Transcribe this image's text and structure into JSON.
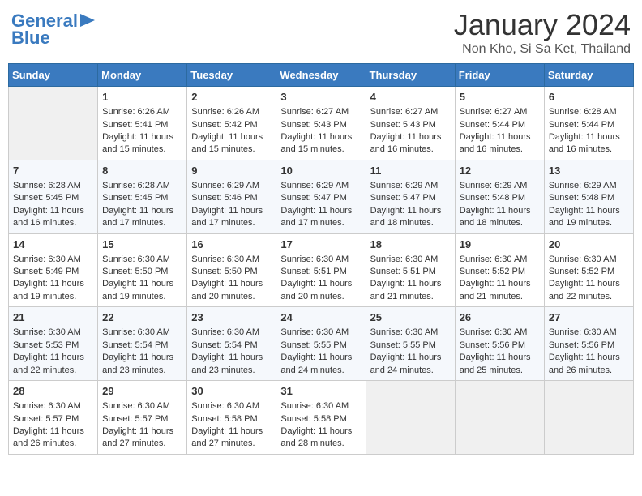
{
  "header": {
    "logo_line1": "General",
    "logo_line2": "Blue",
    "month": "January 2024",
    "location": "Non Kho, Si Sa Ket, Thailand"
  },
  "weekdays": [
    "Sunday",
    "Monday",
    "Tuesday",
    "Wednesday",
    "Thursday",
    "Friday",
    "Saturday"
  ],
  "weeks": [
    [
      {
        "day": "",
        "sunrise": "",
        "sunset": "",
        "daylight": ""
      },
      {
        "day": "1",
        "sunrise": "Sunrise: 6:26 AM",
        "sunset": "Sunset: 5:41 PM",
        "daylight": "Daylight: 11 hours and 15 minutes."
      },
      {
        "day": "2",
        "sunrise": "Sunrise: 6:26 AM",
        "sunset": "Sunset: 5:42 PM",
        "daylight": "Daylight: 11 hours and 15 minutes."
      },
      {
        "day": "3",
        "sunrise": "Sunrise: 6:27 AM",
        "sunset": "Sunset: 5:43 PM",
        "daylight": "Daylight: 11 hours and 15 minutes."
      },
      {
        "day": "4",
        "sunrise": "Sunrise: 6:27 AM",
        "sunset": "Sunset: 5:43 PM",
        "daylight": "Daylight: 11 hours and 16 minutes."
      },
      {
        "day": "5",
        "sunrise": "Sunrise: 6:27 AM",
        "sunset": "Sunset: 5:44 PM",
        "daylight": "Daylight: 11 hours and 16 minutes."
      },
      {
        "day": "6",
        "sunrise": "Sunrise: 6:28 AM",
        "sunset": "Sunset: 5:44 PM",
        "daylight": "Daylight: 11 hours and 16 minutes."
      }
    ],
    [
      {
        "day": "7",
        "sunrise": "Sunrise: 6:28 AM",
        "sunset": "Sunset: 5:45 PM",
        "daylight": "Daylight: 11 hours and 16 minutes."
      },
      {
        "day": "8",
        "sunrise": "Sunrise: 6:28 AM",
        "sunset": "Sunset: 5:45 PM",
        "daylight": "Daylight: 11 hours and 17 minutes."
      },
      {
        "day": "9",
        "sunrise": "Sunrise: 6:29 AM",
        "sunset": "Sunset: 5:46 PM",
        "daylight": "Daylight: 11 hours and 17 minutes."
      },
      {
        "day": "10",
        "sunrise": "Sunrise: 6:29 AM",
        "sunset": "Sunset: 5:47 PM",
        "daylight": "Daylight: 11 hours and 17 minutes."
      },
      {
        "day": "11",
        "sunrise": "Sunrise: 6:29 AM",
        "sunset": "Sunset: 5:47 PM",
        "daylight": "Daylight: 11 hours and 18 minutes."
      },
      {
        "day": "12",
        "sunrise": "Sunrise: 6:29 AM",
        "sunset": "Sunset: 5:48 PM",
        "daylight": "Daylight: 11 hours and 18 minutes."
      },
      {
        "day": "13",
        "sunrise": "Sunrise: 6:29 AM",
        "sunset": "Sunset: 5:48 PM",
        "daylight": "Daylight: 11 hours and 19 minutes."
      }
    ],
    [
      {
        "day": "14",
        "sunrise": "Sunrise: 6:30 AM",
        "sunset": "Sunset: 5:49 PM",
        "daylight": "Daylight: 11 hours and 19 minutes."
      },
      {
        "day": "15",
        "sunrise": "Sunrise: 6:30 AM",
        "sunset": "Sunset: 5:50 PM",
        "daylight": "Daylight: 11 hours and 19 minutes."
      },
      {
        "day": "16",
        "sunrise": "Sunrise: 6:30 AM",
        "sunset": "Sunset: 5:50 PM",
        "daylight": "Daylight: 11 hours and 20 minutes."
      },
      {
        "day": "17",
        "sunrise": "Sunrise: 6:30 AM",
        "sunset": "Sunset: 5:51 PM",
        "daylight": "Daylight: 11 hours and 20 minutes."
      },
      {
        "day": "18",
        "sunrise": "Sunrise: 6:30 AM",
        "sunset": "Sunset: 5:51 PM",
        "daylight": "Daylight: 11 hours and 21 minutes."
      },
      {
        "day": "19",
        "sunrise": "Sunrise: 6:30 AM",
        "sunset": "Sunset: 5:52 PM",
        "daylight": "Daylight: 11 hours and 21 minutes."
      },
      {
        "day": "20",
        "sunrise": "Sunrise: 6:30 AM",
        "sunset": "Sunset: 5:52 PM",
        "daylight": "Daylight: 11 hours and 22 minutes."
      }
    ],
    [
      {
        "day": "21",
        "sunrise": "Sunrise: 6:30 AM",
        "sunset": "Sunset: 5:53 PM",
        "daylight": "Daylight: 11 hours and 22 minutes."
      },
      {
        "day": "22",
        "sunrise": "Sunrise: 6:30 AM",
        "sunset": "Sunset: 5:54 PM",
        "daylight": "Daylight: 11 hours and 23 minutes."
      },
      {
        "day": "23",
        "sunrise": "Sunrise: 6:30 AM",
        "sunset": "Sunset: 5:54 PM",
        "daylight": "Daylight: 11 hours and 23 minutes."
      },
      {
        "day": "24",
        "sunrise": "Sunrise: 6:30 AM",
        "sunset": "Sunset: 5:55 PM",
        "daylight": "Daylight: 11 hours and 24 minutes."
      },
      {
        "day": "25",
        "sunrise": "Sunrise: 6:30 AM",
        "sunset": "Sunset: 5:55 PM",
        "daylight": "Daylight: 11 hours and 24 minutes."
      },
      {
        "day": "26",
        "sunrise": "Sunrise: 6:30 AM",
        "sunset": "Sunset: 5:56 PM",
        "daylight": "Daylight: 11 hours and 25 minutes."
      },
      {
        "day": "27",
        "sunrise": "Sunrise: 6:30 AM",
        "sunset": "Sunset: 5:56 PM",
        "daylight": "Daylight: 11 hours and 26 minutes."
      }
    ],
    [
      {
        "day": "28",
        "sunrise": "Sunrise: 6:30 AM",
        "sunset": "Sunset: 5:57 PM",
        "daylight": "Daylight: 11 hours and 26 minutes."
      },
      {
        "day": "29",
        "sunrise": "Sunrise: 6:30 AM",
        "sunset": "Sunset: 5:57 PM",
        "daylight": "Daylight: 11 hours and 27 minutes."
      },
      {
        "day": "30",
        "sunrise": "Sunrise: 6:30 AM",
        "sunset": "Sunset: 5:58 PM",
        "daylight": "Daylight: 11 hours and 27 minutes."
      },
      {
        "day": "31",
        "sunrise": "Sunrise: 6:30 AM",
        "sunset": "Sunset: 5:58 PM",
        "daylight": "Daylight: 11 hours and 28 minutes."
      },
      {
        "day": "",
        "sunrise": "",
        "sunset": "",
        "daylight": ""
      },
      {
        "day": "",
        "sunrise": "",
        "sunset": "",
        "daylight": ""
      },
      {
        "day": "",
        "sunrise": "",
        "sunset": "",
        "daylight": ""
      }
    ]
  ]
}
